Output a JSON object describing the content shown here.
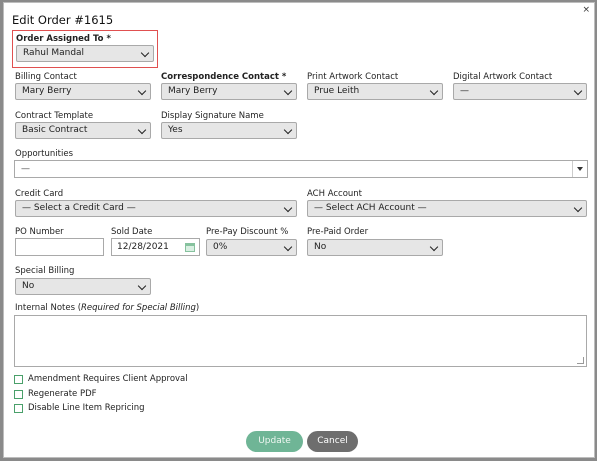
{
  "dialog": {
    "title": "Edit Order #1615",
    "close_symbol": "×"
  },
  "order_assigned_to": {
    "label": "Order Assigned To *",
    "value": "Rahul Mandal"
  },
  "billing_contact": {
    "label": "Billing Contact",
    "value": "Mary Berry"
  },
  "correspondence_contact": {
    "label": "Correspondence Contact *",
    "value": "Mary Berry"
  },
  "print_artwork_contact": {
    "label": "Print Artwork Contact",
    "value": "Prue Leith"
  },
  "digital_artwork_contact": {
    "label": "Digital Artwork Contact",
    "value": "—"
  },
  "contract_template": {
    "label": "Contract Template",
    "value": "Basic Contract"
  },
  "display_signature_name": {
    "label": "Display Signature Name",
    "value": "Yes"
  },
  "opportunities": {
    "label": "Opportunities",
    "value": "—"
  },
  "credit_card": {
    "label": "Credit Card",
    "value": "— Select a Credit Card —"
  },
  "ach_account": {
    "label": "ACH Account",
    "value": "— Select ACH Account —"
  },
  "po_number": {
    "label": "PO Number",
    "value": ""
  },
  "sold_date": {
    "label": "Sold Date",
    "value": "12/28/2021"
  },
  "prepay_discount": {
    "label": "Pre-Pay Discount %",
    "value": "0%"
  },
  "prepaid_order": {
    "label": "Pre-Paid Order",
    "value": "No"
  },
  "special_billing": {
    "label": "Special Billing",
    "value": "No"
  },
  "internal_notes": {
    "label": "Internal Notes (",
    "label_italic": "Required for Special Billing",
    "label_end": ")",
    "value": ""
  },
  "checkboxes": [
    {
      "label": "Amendment Requires Client Approval",
      "checked": false
    },
    {
      "label": "Regenerate PDF",
      "checked": false
    },
    {
      "label": "Disable Line Item Repricing",
      "checked": false
    }
  ],
  "buttons": {
    "update": "Update",
    "cancel": "Cancel"
  },
  "colors": {
    "highlight_border": "#e05050",
    "update_button": "#6fb596",
    "cancel_button": "#6e6e6e",
    "checkbox_border": "#4aa06a"
  }
}
